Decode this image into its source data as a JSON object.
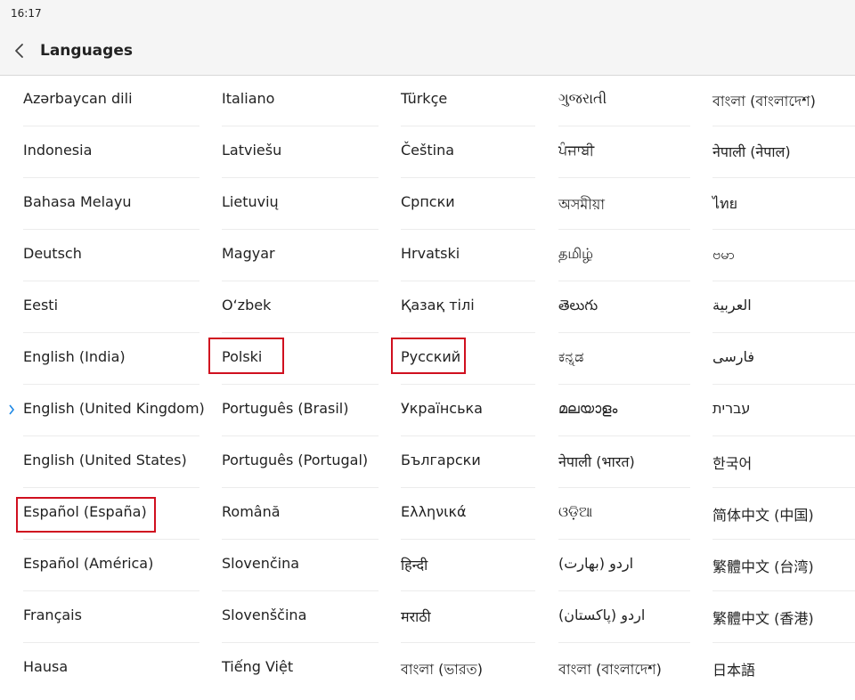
{
  "status": {
    "time": "16:17"
  },
  "header": {
    "title": "Languages"
  },
  "colors": {
    "accent": "#1e88e5",
    "highlight": "#d0101f"
  },
  "columns": [
    {
      "items": [
        "Azərbaycan dili",
        "Indonesia",
        "Bahasa Melayu",
        "Deutsch",
        "Eesti",
        "English (India)",
        "English (United Kingdom)",
        "English (United States)",
        "Español (España)",
        "Español (América)",
        "Français",
        "Hausa"
      ]
    },
    {
      "items": [
        "Italiano",
        "Latviešu",
        "Lietuvių",
        "Magyar",
        "O‘zbek",
        "Polski",
        "Português (Brasil)",
        "Português (Portugal)",
        "Română",
        "Slovenčina",
        "Slovenščina",
        "Tiếng Việt"
      ]
    },
    {
      "items": [
        "Türkçe",
        "Čeština",
        "Српски",
        "Hrvatski",
        "Қазақ тілі",
        "Русский",
        "Українська",
        "Български",
        "Ελληνικά",
        "हिन्दी",
        "मराठी",
        "বাংলা (ভারত)"
      ]
    },
    {
      "items": [
        "ગુજરાતી",
        "ਪੰਜਾਬੀ",
        "অসমীয়া",
        "தமிழ்",
        "తెలుగు",
        "ಕನ್ನಡ",
        "മലയാളം",
        "नेपाली (भारत)",
        "ଓଡ଼ିଆ",
        "اردو (بھارت)",
        "اردو (پاکستان)",
        "বাংলা (বাংলাদেশ)"
      ]
    },
    {
      "items": [
        "বাংলা (বাংলাদেশ)",
        "नेपाली (नेपाल)",
        "ไทย",
        "ဗမာ",
        "العربية",
        "فارسی",
        "עברית",
        "한국어",
        "简体中文 (中国)",
        "繁體中文 (台湾)",
        "繁體中文 (香港)",
        "日本語"
      ]
    }
  ],
  "selected_language": "English (United Kingdom)",
  "highlighted_languages": [
    "Español (España)",
    "Polski",
    "Русский"
  ]
}
